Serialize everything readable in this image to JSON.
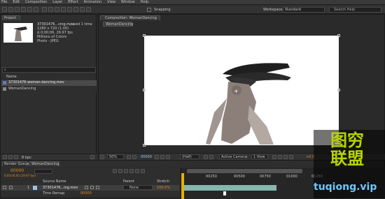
{
  "menu": [
    "File",
    "Edit",
    "Composition",
    "Layer",
    "Effect",
    "Animation",
    "View",
    "Window",
    "Help"
  ],
  "toolbar": {
    "snapping": "Snapping",
    "workspace_label": "Workspace:",
    "workspace_value": "Standard",
    "search_placeholder": "Search Help"
  },
  "project_panel": {
    "tab": "Project",
    "selected_file": "37301476...cing.mov",
    "used": ", used 1 time",
    "info": [
      "1280 x 720 (1.00)",
      "Δ 0;00;06, 29.97 fps",
      "Millions of Colors",
      "Photo - JPEG"
    ],
    "column_name": "Name",
    "items": [
      "37301476-woman-dancing.mov",
      "WomanDancing"
    ],
    "bpc": "8 bpc"
  },
  "composition_panel": {
    "tab": "Composition: WomanDancing",
    "comp_tab": "WomanDancing",
    "zoom": "50%",
    "timecode": "00000",
    "resolution": "(Half)",
    "camera": "Active Camera",
    "view": "1 View",
    "offset": "+0.0"
  },
  "timeline": {
    "tabs": [
      "Render Queue",
      "WomanDancing"
    ],
    "timecode": "00000",
    "fps_info": "0;00;00;00 (29.97 fps)",
    "col_source": "Source Name",
    "col_parent": "Parent",
    "col_stretch": "Stretch",
    "layer_num": "1",
    "layer_name": "37301476...ing.mov",
    "parent_value": "None",
    "stretch_value": "100.0%",
    "time_remap": "Time Remap",
    "time_remap_value": "00000",
    "ruler": [
      "00250",
      "00500",
      "00750",
      "01000",
      "01250"
    ]
  },
  "watermark": {
    "line1": "图穷",
    "line2": "联盟",
    "url": "tuqiong.vip"
  }
}
